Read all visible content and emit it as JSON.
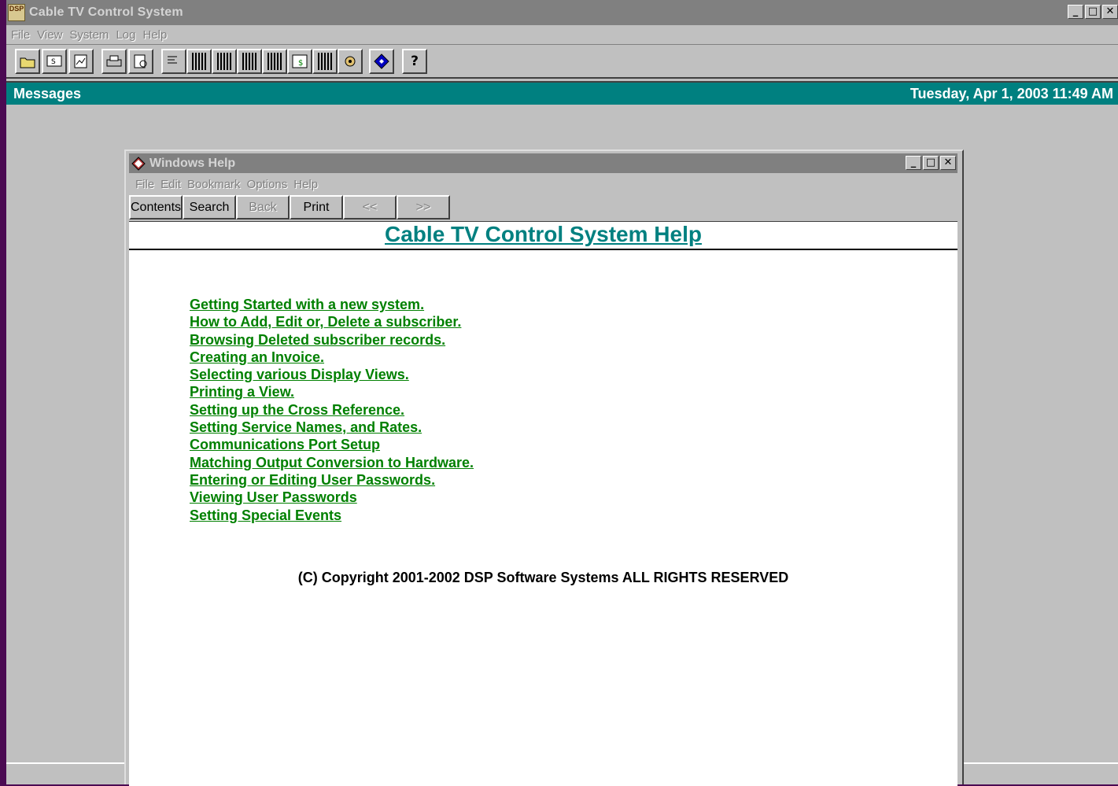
{
  "app": {
    "title": "Cable TV Control System",
    "icon_text": "DSP",
    "window_buttons": [
      "_",
      "□",
      "✕"
    ]
  },
  "menubar": {
    "items": [
      "File",
      "View",
      "System",
      "Log",
      "Help"
    ]
  },
  "toolbar": {
    "icons": [
      "open-folder-icon",
      "screen-icon",
      "report-icon",
      "printer-icon",
      "print-preview-icon",
      "text-list-icon",
      "column-view-icon",
      "column-view-icon",
      "column-view-icon",
      "column-detail-icon",
      "billing-view-icon",
      "column-view-icon",
      "settings-icon",
      "diamond-icon",
      "help-question-icon"
    ]
  },
  "messages_bar": {
    "title": "Messages",
    "datetime": "Tuesday, Apr  1, 2003 11:49 AM"
  },
  "help_window": {
    "title": "Windows Help",
    "menu": [
      "File",
      "Edit",
      "Bookmark",
      "Options",
      "Help"
    ],
    "buttons": {
      "contents": "Contents",
      "search": "Search",
      "back": "Back",
      "print": "Print",
      "prev": "<<",
      "next": ">>"
    },
    "heading": "Cable TV Control System Help",
    "topics": [
      "Getting Started with a new system.",
      "How to Add, Edit or, Delete a subscriber.",
      "Browsing Deleted subscriber records.",
      "Creating an Invoice.",
      "Selecting various Display Views.",
      "Printing a View.",
      "Setting up the Cross Reference.",
      "Setting Service Names, and Rates.",
      "Communications Port Setup",
      "Matching Output Conversion to Hardware.",
      "Entering or Editing User Passwords.",
      "Viewing User Passwords",
      "Setting Special Events"
    ],
    "copyright": "(C) Copyright 2001-2002 DSP Software Systems ALL RIGHTS RESERVED"
  },
  "colors": {
    "desktop": "#4b0a52",
    "accent_teal": "#008080",
    "link_green": "#008000",
    "window_gray": "#c0c0c0"
  }
}
